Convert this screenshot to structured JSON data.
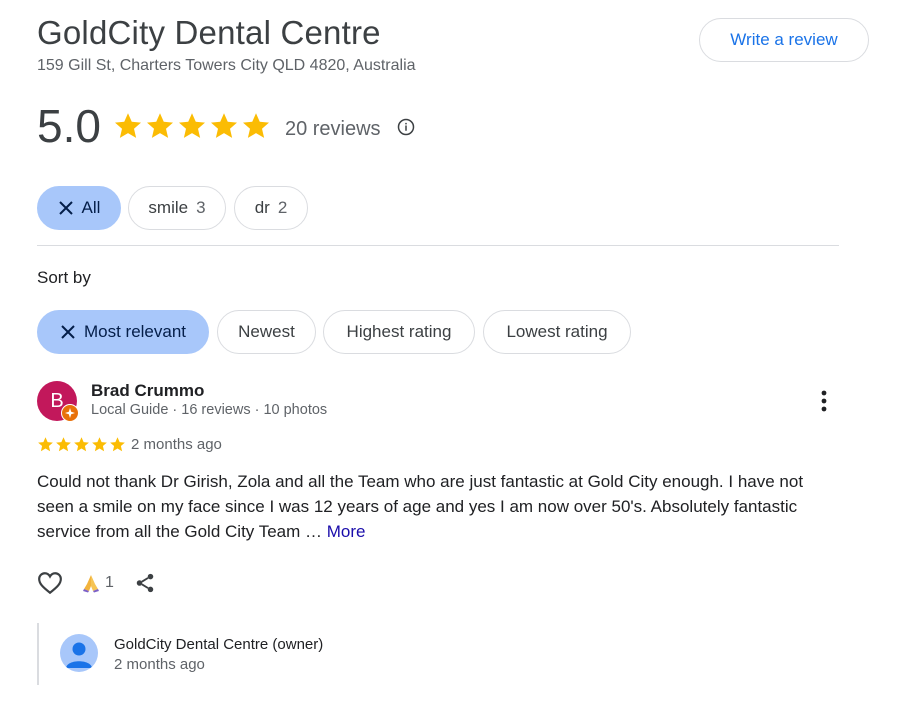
{
  "business": {
    "name": "GoldCity Dental Centre",
    "address": "159 Gill St, Charters Towers City QLD 4820, Australia",
    "write_review_label": "Write a review",
    "rating": "5.0",
    "stars": 5,
    "reviews_count": "20 reviews"
  },
  "filters": [
    {
      "label": "All",
      "count": "",
      "selected": true
    },
    {
      "label": "smile",
      "count": "3",
      "selected": false
    },
    {
      "label": "dr",
      "count": "2",
      "selected": false
    }
  ],
  "sort": {
    "label": "Sort by",
    "options": [
      {
        "label": "Most relevant",
        "selected": true
      },
      {
        "label": "Newest",
        "selected": false
      },
      {
        "label": "Highest rating",
        "selected": false
      },
      {
        "label": "Lowest rating",
        "selected": false
      }
    ]
  },
  "review": {
    "avatar_letter": "B",
    "avatar_color": "#c2185b",
    "name": "Brad Crummo",
    "meta": "Local Guide · 16 reviews · 10 photos",
    "stars": 5,
    "date": "2 months ago",
    "text": "Could not thank Dr Girish, Zola and all the Team who are just fantastic at Gold City enough. I have not seen a smile on my face since I was 12 years of age and yes I am now over 50's. Absolutely fantastic service from all the Gold City Team … ",
    "more_label": "More",
    "reaction_count": "1"
  },
  "owner_response": {
    "name": "GoldCity Dental Centre (owner)",
    "date": "2 months ago"
  },
  "colors": {
    "star": "#fbbc04",
    "chip_selected": "#a8c7fa",
    "link": "#1a0dab",
    "accent": "#1a73e8"
  }
}
